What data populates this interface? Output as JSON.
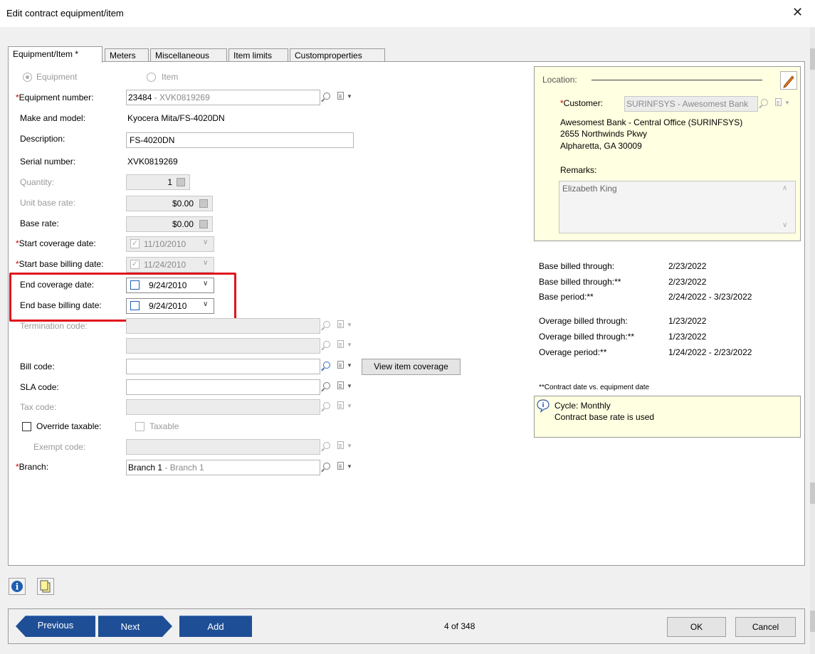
{
  "window": {
    "title": "Edit contract equipment/item",
    "close_glyph": "✕"
  },
  "tabs": [
    {
      "label": "Equipment/Item *"
    },
    {
      "label": "Meters"
    },
    {
      "label": "Miscellaneous"
    },
    {
      "label": "Item limits"
    },
    {
      "label": "Customproperties"
    }
  ],
  "type_radio": {
    "equipment": "Equipment",
    "item": "Item"
  },
  "form": {
    "equipment_number": {
      "label": "Equipment number:",
      "code": "23484",
      "desc": " - XVK0819269"
    },
    "make_model": {
      "label": "Make and model:",
      "value": "Kyocera Mita/FS-4020DN"
    },
    "description": {
      "label": "Description:",
      "value": "FS-4020DN"
    },
    "serial_number": {
      "label": "Serial number:",
      "value": "XVK0819269"
    },
    "quantity": {
      "label": "Quantity:",
      "value": "1"
    },
    "unit_base_rate": {
      "label": "Unit base rate:",
      "value": "$0.00"
    },
    "base_rate": {
      "label": "Base rate:",
      "value": "$0.00"
    },
    "start_coverage_date": {
      "label": "Start coverage date:",
      "value": "11/10/2010"
    },
    "start_base_billing_date": {
      "label": "Start base billing date:",
      "value": "11/24/2010"
    },
    "end_coverage_date": {
      "label": "End coverage date:",
      "value": "9/24/2010"
    },
    "end_base_billing_date": {
      "label": "End base billing date:",
      "value": "9/24/2010"
    },
    "termination_code": {
      "label": "Termination code:"
    },
    "bill_code": {
      "label": "Bill code:",
      "button": "View item coverage"
    },
    "sla_code": {
      "label": "SLA code:"
    },
    "tax_code": {
      "label": "Tax code:"
    },
    "override_taxable": {
      "label": "Override taxable:",
      "taxable_label": "Taxable"
    },
    "exempt_code": {
      "label": "Exempt code:"
    },
    "branch": {
      "label": "Branch:",
      "code": "Branch 1",
      "desc": " - Branch 1"
    }
  },
  "location": {
    "legend": "Location:",
    "customer_label": "Customer:",
    "customer_value": "SURINFSYS - Awesomest Bank",
    "address_lines": [
      "Awesomest Bank - Central Office (SURINFSYS)",
      "2655 Northwinds Pkwy",
      "Alpharetta, GA 30009"
    ],
    "remarks_label": "Remarks:",
    "remarks_value": "Elizabeth King"
  },
  "billing": {
    "rows": [
      {
        "label": "Base billed through:",
        "value": "2/23/2022"
      },
      {
        "label": "Base billed through:**",
        "value": "2/23/2022"
      },
      {
        "label": "Base period:**",
        "value": "2/24/2022 - 3/23/2022"
      },
      {
        "label": "Overage billed through:",
        "value": "1/23/2022"
      },
      {
        "label": "Overage billed through:**",
        "value": "1/23/2022"
      },
      {
        "label": "Overage period:**",
        "value": "1/24/2022 - 2/23/2022"
      }
    ],
    "footnote": "**Contract date vs. equipment date"
  },
  "note": {
    "line1": "Cycle: Monthly",
    "line2": "Contract base rate is used"
  },
  "nav": {
    "previous": "Previous",
    "next": "Next",
    "add": "Add",
    "record_position": "4 of 348",
    "ok": "OK",
    "cancel": "Cancel"
  },
  "colors": {
    "accent_blue": "#1e4e96",
    "highlight_red": "#e0141d",
    "note_yellow": "#ffffe1"
  }
}
